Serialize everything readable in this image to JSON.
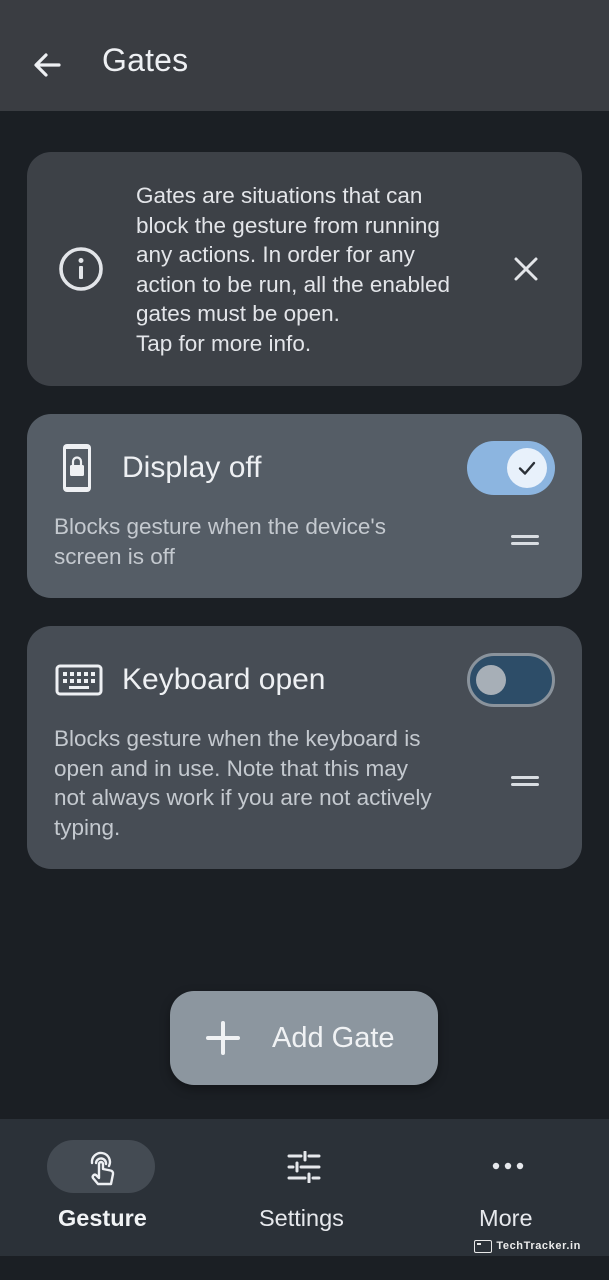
{
  "topbar": {
    "title": "Gates",
    "back_icon": "arrow-left-icon"
  },
  "info_card": {
    "icon": "info-circle-icon",
    "lines": [
      "Gates are situations that can",
      "block the gesture from running",
      "any actions. In order for any",
      "action to be run, all the enabled",
      "gates must be open.",
      "Tap for more info."
    ],
    "close_icon": "close-icon"
  },
  "gates": [
    {
      "icon": "lock-phone-icon",
      "title": "Display off",
      "enabled": true,
      "description_lines": [
        "Blocks gesture when the device's",
        "screen is off"
      ]
    },
    {
      "icon": "keyboard-icon",
      "title": "Keyboard open",
      "enabled": false,
      "description_lines": [
        "Blocks gesture when the keyboard is",
        "open and in use. Note that this may",
        "not always work if you are not actively",
        "typing."
      ]
    }
  ],
  "fab": {
    "icon": "plus-icon",
    "label": "Add Gate"
  },
  "bottom_nav": {
    "items": [
      {
        "label": "Gesture",
        "icon": "touch-gesture-icon",
        "active": true
      },
      {
        "label": "Settings",
        "icon": "sliders-icon",
        "active": false
      },
      {
        "label": "More",
        "icon": "more-horizontal-icon",
        "active": false
      }
    ]
  },
  "watermark": {
    "text": "TechTracker.in"
  },
  "colors": {
    "topbar_bg": "#3a3d42",
    "page_bg": "#1b1f24",
    "toggle_on": "#8cb5e0",
    "toggle_off_track": "#2d4d68",
    "fab_bg": "#8c969f"
  }
}
